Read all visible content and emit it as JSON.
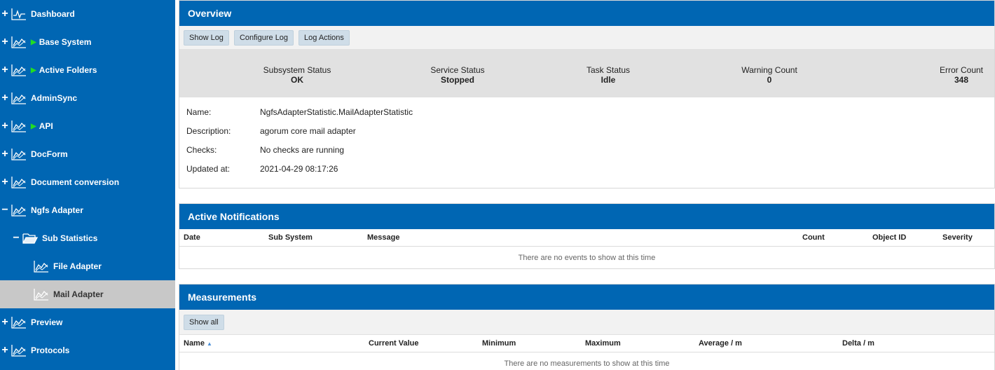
{
  "sidebar": {
    "items": [
      {
        "toggle": "+",
        "label": "Dashboard",
        "arrow": "",
        "icon": "dashboard-icon"
      },
      {
        "toggle": "+",
        "label": "Base System",
        "arrow": "▶",
        "icon": "chart-icon"
      },
      {
        "toggle": "+",
        "label": "Active Folders",
        "arrow": "▶",
        "icon": "chart-icon"
      },
      {
        "toggle": "+",
        "label": "AdminSync",
        "arrow": "",
        "icon": "chart-icon"
      },
      {
        "toggle": "+",
        "label": "API",
        "arrow": "▶",
        "icon": "chart-icon"
      },
      {
        "toggle": "+",
        "label": "DocForm",
        "arrow": "",
        "icon": "chart-icon"
      },
      {
        "toggle": "+",
        "label": "Document conversion",
        "arrow": "",
        "icon": "chart-icon"
      },
      {
        "toggle": "−",
        "label": "Ngfs Adapter",
        "arrow": "",
        "icon": "chart-icon"
      },
      {
        "toggle": "−",
        "label": "Sub Statistics",
        "arrow": "",
        "icon": "folder-open-icon"
      },
      {
        "toggle": "",
        "label": "File Adapter",
        "arrow": "",
        "icon": "chart-icon"
      },
      {
        "toggle": "",
        "label": "Mail Adapter",
        "arrow": "",
        "icon": "chart-icon",
        "selected": true
      },
      {
        "toggle": "+",
        "label": "Preview",
        "arrow": "",
        "icon": "chart-icon"
      },
      {
        "toggle": "+",
        "label": "Protocols",
        "arrow": "",
        "icon": "chart-icon"
      }
    ]
  },
  "overview": {
    "title": "Overview",
    "buttons": {
      "show_log": "Show Log",
      "configure_log": "Configure Log",
      "log_actions": "Log Actions"
    },
    "status": {
      "subsystem": {
        "label": "Subsystem Status",
        "value": "OK"
      },
      "service": {
        "label": "Service Status",
        "value": "Stopped"
      },
      "task": {
        "label": "Task Status",
        "value": "Idle"
      },
      "warning": {
        "label": "Warning Count",
        "value": "0"
      },
      "error": {
        "label": "Error Count",
        "value": "348"
      }
    },
    "info": {
      "name_label": "Name:",
      "name": "NgfsAdapterStatistic.MailAdapterStatistic",
      "description_label": "Description:",
      "description": "agorum core mail adapter",
      "checks_label": "Checks:",
      "checks": "No checks are running",
      "updated_label": "Updated at:",
      "updated": "2021-04-29 08:17:26"
    }
  },
  "notifications": {
    "title": "Active Notifications",
    "columns": {
      "date": "Date",
      "sub_system": "Sub System",
      "message": "Message",
      "count": "Count",
      "object_id": "Object ID",
      "severity": "Severity"
    },
    "empty": "There are no events to show at this time"
  },
  "measurements": {
    "title": "Measurements",
    "show_all": "Show all",
    "columns": {
      "name": "Name",
      "current": "Current Value",
      "minimum": "Minimum",
      "maximum": "Maximum",
      "average": "Average / m",
      "delta": "Delta / m"
    },
    "empty": "There are no measurements to show at this time"
  }
}
